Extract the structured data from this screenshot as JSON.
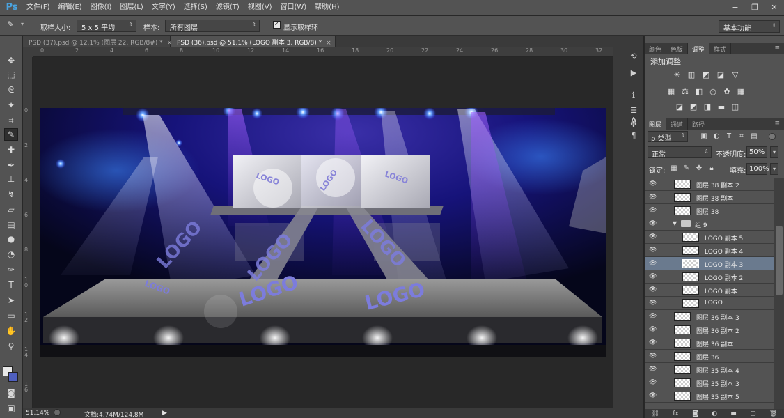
{
  "app": {
    "logo": "Ps",
    "menu": [
      "文件(F)",
      "编辑(E)",
      "图像(I)",
      "图层(L)",
      "文字(Y)",
      "选择(S)",
      "滤镜(T)",
      "视图(V)",
      "窗口(W)",
      "帮助(H)"
    ]
  },
  "window_controls": {
    "minimize": "−",
    "restore": "❐",
    "close": "✕"
  },
  "options_bar": {
    "sample_size_label": "取样大小:",
    "sample_size_value": "5 x 5 平均",
    "sample_label": "样本:",
    "sample_value": "所有图层",
    "show_ring_label": "显示取样环",
    "show_ring_checked": true,
    "workspace": "基本功能"
  },
  "tabs": [
    {
      "label": "PSD (37).psd @ 12.1% (图层 22, RGB/8#) *",
      "active": false,
      "close": "×"
    },
    {
      "label": "PSD (36).psd @ 51.1% (LOGO 副本 3, RGB/8) *",
      "active": true,
      "close": "×"
    }
  ],
  "ruler_h": [
    "0",
    "2",
    "4",
    "6",
    "8",
    "10",
    "12",
    "14",
    "16",
    "18",
    "20",
    "22",
    "24",
    "26",
    "28",
    "30",
    "32"
  ],
  "ruler_v": [
    "0",
    "2",
    "4",
    "6",
    "8",
    "1\n0",
    "1\n2",
    "1\n4",
    "1\n6"
  ],
  "canvas": {
    "logo_text": "LOGO"
  },
  "status": {
    "zoom": "51.14%",
    "doc_info": "文档:4.74M/124.8M"
  },
  "panel_tabs_top": [
    "颜色",
    "色板",
    "调整",
    "样式"
  ],
  "panel_tabs_top_active": 2,
  "adjustments_title": "添加调整",
  "panel_tabs_layers": [
    "图层",
    "通道",
    "路径"
  ],
  "panel_tabs_layers_active": 0,
  "layers_panel": {
    "filter": "ρ 类型",
    "blend_mode": "正常",
    "opacity_label": "不透明度:",
    "opacity": "50%",
    "lock_label": "锁定:",
    "fill_label": "填充:",
    "fill": "100%"
  },
  "layers": [
    {
      "name": "图层 38 副本 2",
      "indent": 0,
      "type": "layer",
      "selected": false
    },
    {
      "name": "图层 38 副本",
      "indent": 0,
      "type": "layer",
      "selected": false
    },
    {
      "name": "图层 38",
      "indent": 0,
      "type": "layer",
      "selected": false
    },
    {
      "name": "组 9",
      "indent": 0,
      "type": "group",
      "selected": false
    },
    {
      "name": "LOGO 副本 5",
      "indent": 1,
      "type": "layer",
      "selected": false
    },
    {
      "name": "LOGO 副本 4",
      "indent": 1,
      "type": "layer",
      "selected": false
    },
    {
      "name": "LOGO 副本 3",
      "indent": 1,
      "type": "layer",
      "selected": true
    },
    {
      "name": "LOGO 副本 2",
      "indent": 1,
      "type": "layer",
      "selected": false
    },
    {
      "name": "LOGO 副本",
      "indent": 1,
      "type": "layer",
      "selected": false
    },
    {
      "name": "LOGO",
      "indent": 1,
      "type": "layer",
      "selected": false
    },
    {
      "name": "图层 36 副本 3",
      "indent": 0,
      "type": "layer",
      "selected": false
    },
    {
      "name": "图层 36 副本 2",
      "indent": 0,
      "type": "layer",
      "selected": false
    },
    {
      "name": "图层 36 副本",
      "indent": 0,
      "type": "layer",
      "selected": false
    },
    {
      "name": "图层 36",
      "indent": 0,
      "type": "layer",
      "selected": false
    },
    {
      "name": "图层 35 副本 4",
      "indent": 0,
      "type": "layer",
      "selected": false
    },
    {
      "name": "图层 35 副本 3",
      "indent": 0,
      "type": "layer",
      "selected": false
    },
    {
      "name": "图层 35 副本 5",
      "indent": 0,
      "type": "layer",
      "selected": false
    }
  ]
}
